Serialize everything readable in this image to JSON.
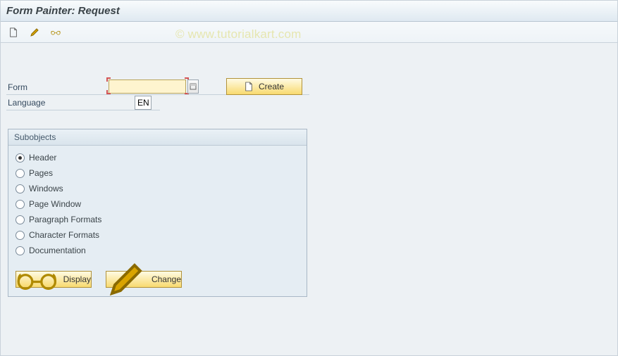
{
  "title": "Form Painter: Request",
  "watermark": "© www.tutorialkart.com",
  "toolbar": {
    "new_tooltip": "Create",
    "change_tooltip": "Change",
    "display_tooltip": "Display"
  },
  "fields": {
    "form_label": "Form",
    "form_value": "",
    "language_label": "Language",
    "language_value": "EN"
  },
  "buttons": {
    "create_label": "Create",
    "display_label": "Display",
    "change_label": "Change"
  },
  "groupbox": {
    "title": "Subobjects",
    "options": [
      {
        "label": "Header",
        "checked": true
      },
      {
        "label": "Pages",
        "checked": false
      },
      {
        "label": "Windows",
        "checked": false
      },
      {
        "label": "Page Window",
        "checked": false
      },
      {
        "label": "Paragraph Formats",
        "checked": false
      },
      {
        "label": "Character Formats",
        "checked": false
      },
      {
        "label": "Documentation",
        "checked": false
      }
    ]
  },
  "colors": {
    "accent_yellow": "#f8da6f",
    "panel_blue": "#e5edf3",
    "required_red": "#d35454"
  }
}
